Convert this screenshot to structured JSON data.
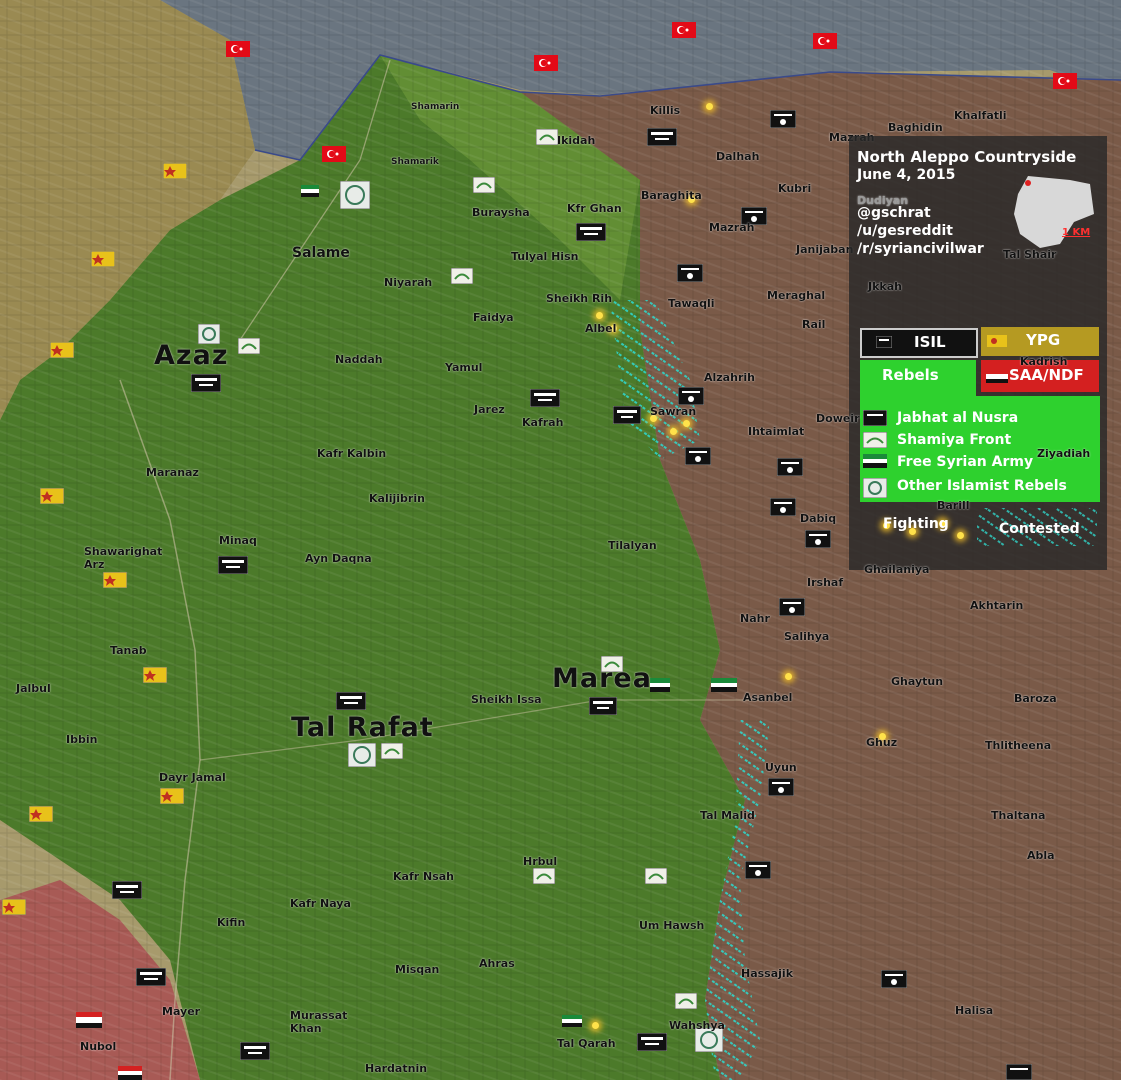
{
  "legend": {
    "title": "North Aleppo Countryside",
    "date": "June 4, 2015",
    "credits": [
      "@gschrat",
      "/u/gesreddit",
      "/r/syriancivilwar"
    ],
    "scale": "1 KM",
    "factions": {
      "isil": "ISIL",
      "ypg": "YPG",
      "rebels": "Rebels",
      "saa": "SAA/NDF"
    },
    "rebel_groups": [
      "Jabhat al Nusra",
      "Shamiya Front",
      "Free Syrian Army",
      "Other Islamist Rebels"
    ],
    "fighting": "Fighting",
    "contested": "Contested"
  },
  "colors": {
    "isil": "#111111",
    "ypg": "#e8c21a",
    "rebels": "#2ed12e",
    "saa": "#d42020",
    "turkey": "#e30a17",
    "contested": "#2fd4c8",
    "fighting": "#ffd23a"
  },
  "towns": {
    "azaz": "Azaz",
    "tal_rafat": "Tal Rafat",
    "marea": "Marea",
    "salame": "Salame",
    "shamarin": "Shamarin",
    "shamarik": "Shamarik",
    "ikidah": "Ikidah",
    "killis": "Killis",
    "dalhah": "Dalhah",
    "baraghita": "Baraghita",
    "buraysha": "Buraysha",
    "kfr_ghan": "Kfr Ghan",
    "tulyal_hisn": "Tulyal Hisn",
    "niyarah": "Niyarah",
    "sheikh_rih": "Sheikh Rih",
    "albel": "Albel",
    "faidya": "Faidya",
    "tawaqli": "Tawaqli",
    "naddah": "Naddah",
    "yamul": "Yamul",
    "jarez": "Jarez",
    "kafrah": "Kafrah",
    "sawran": "Sawran",
    "alzahrih": "Alzahrih",
    "ihtaimlat": "Ihtaimlat",
    "kafr_kalbin": "Kafr Kalbin",
    "maranaz": "Maranaz",
    "kalijibrin": "Kalijibrin",
    "minaq": "Minaq",
    "shawarighat_arz": "Shawarighat Arz",
    "ayn_daqna": "Ayn Daqna",
    "tilalyan": "Tilalyan",
    "tanab": "Tanab",
    "jalbul": "Jalbul",
    "ibbin": "Ibbin",
    "sheikh_issa": "Sheikh Issa",
    "asanbel": "Asanbel",
    "dayr_jamal": "Dayr Jamal",
    "kafr_nsah": "Kafr Nsah",
    "hrbul": "Hrbul",
    "kafr_naya": "Kafr Naya",
    "kifin": "Kifin",
    "um_hawsh": "Um Hawsh",
    "misqan": "Misqan",
    "ahras": "Ahras",
    "hassajik": "Hassajik",
    "mayer": "Mayer",
    "murassat_khan": "Murassat\nKhan",
    "nubol": "Nubol",
    "tal_qarah": "Tal Qarah",
    "wahshya": "Wahshya",
    "hardatnin": "Hardatnin",
    "mazrah_n": "Mazrah",
    "baghidin": "Baghidin",
    "khalfatli": "Khalfatli",
    "kubri": "Kubri",
    "mazrah": "Mazrah",
    "janijaban": "Janijaban",
    "tal_shair": "Tal Shair",
    "meraghal": "Meraghal",
    "jkkah": "Jkkah",
    "rail": "Rail",
    "kadrish": "Kadrish",
    "doweir": "Doweir",
    "ziyadiah": "Ziyadiah",
    "barill": "Barill",
    "dabiq": "Dabiq",
    "ghailaniya": "Ghailaniya",
    "irshaf": "Irshaf",
    "akhtarin": "Akhtarin",
    "nahr": "Nahr",
    "salihya": "Salihya",
    "ghaytun": "Ghaytun",
    "baroza": "Baroza",
    "ghuz": "Ghuz",
    "thlitheena": "Thlitheena",
    "uyun": "Uyun",
    "tal_malid": "Tal Malid",
    "thaltana": "Thaltana",
    "abla": "Abla",
    "halisa": "Halisa",
    "dudiyan": "Dudiyan"
  }
}
